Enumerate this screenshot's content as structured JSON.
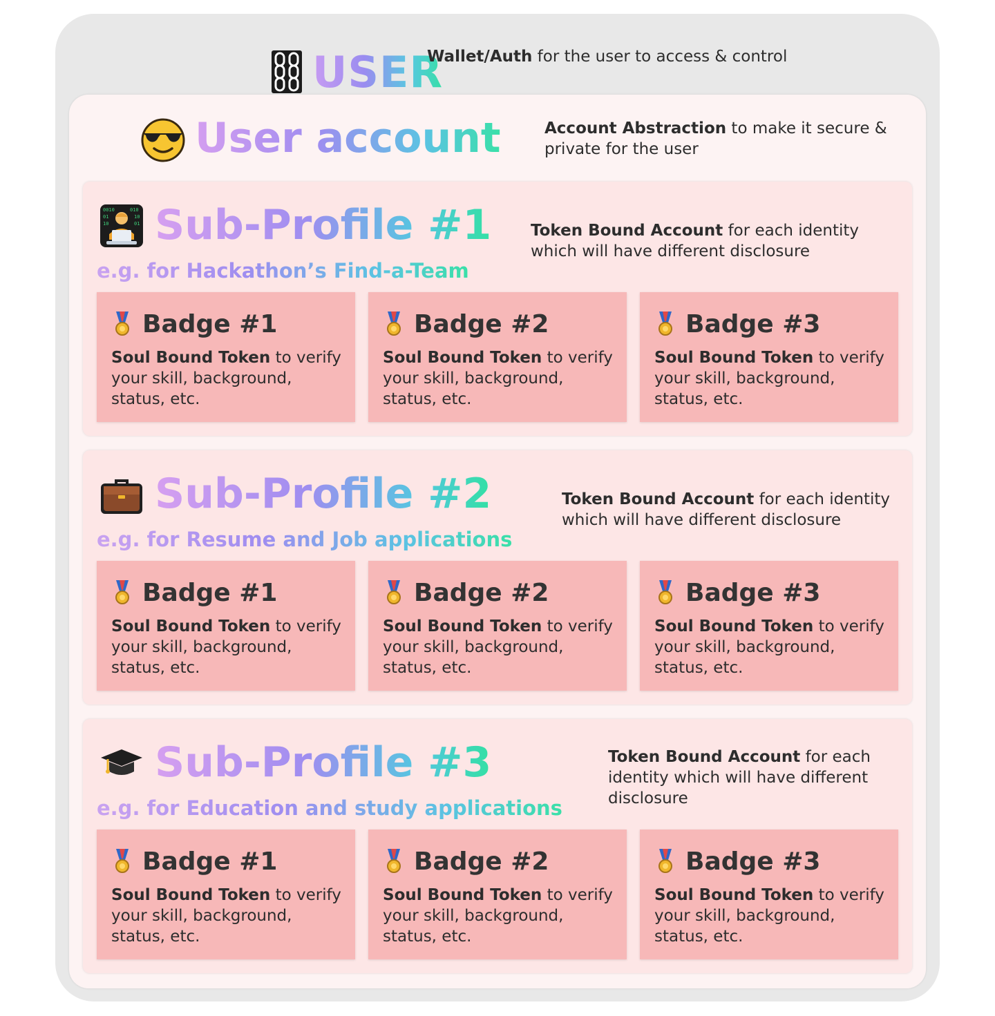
{
  "user": {
    "title": "USER",
    "desc_bold": "Wallet/Auth",
    "desc_rest": " for the user to access & control"
  },
  "account": {
    "title": "User account",
    "desc_bold": "Account Abstraction",
    "desc_rest": " to make it secure & private for the user"
  },
  "subprofiles": [
    {
      "title": "Sub-Profile #1",
      "subtitle": "e.g. for Hackathon’s Find-a-Team",
      "desc_bold": "Token Bound Account",
      "desc_rest": " for each identity which will have different disclosure",
      "icon": "technologist-icon",
      "badges": [
        {
          "title": "Badge #1",
          "desc_bold": "Soul Bound Token",
          "desc_rest": " to verify your skill, background, status, etc."
        },
        {
          "title": "Badge #2",
          "desc_bold": "Soul Bound Token",
          "desc_rest": " to verify your skill, background, status, etc."
        },
        {
          "title": "Badge #3",
          "desc_bold": "Soul Bound Token",
          "desc_rest": " to verify your skill, background, status, etc."
        }
      ]
    },
    {
      "title": "Sub-Profile #2",
      "subtitle": "e.g. for Resume and Job applications",
      "desc_bold": "Token Bound Account",
      "desc_rest": " for each identity which will have different disclosure",
      "icon": "briefcase-icon",
      "badges": [
        {
          "title": "Badge #1",
          "desc_bold": "Soul Bound Token",
          "desc_rest": " to verify your skill, background, status, etc."
        },
        {
          "title": "Badge #2",
          "desc_bold": "Soul Bound Token",
          "desc_rest": " to verify your skill, background, status, etc."
        },
        {
          "title": "Badge #3",
          "desc_bold": "Soul Bound Token",
          "desc_rest": " to verify your skill, background, status, etc."
        }
      ]
    },
    {
      "title": "Sub-Profile #3",
      "subtitle": "e.g. for Education and study applications",
      "desc_bold": "Token Bound Account",
      "desc_rest": " for each identity which will have different disclosure",
      "icon": "graduation-cap-icon",
      "badges": [
        {
          "title": "Badge #1",
          "desc_bold": "Soul Bound Token",
          "desc_rest": " to verify your skill, background, status, etc."
        },
        {
          "title": "Badge #2",
          "desc_bold": "Soul Bound Token",
          "desc_rest": " to verify your skill, background, status, etc."
        },
        {
          "title": "Badge #3",
          "desc_bold": "Soul Bound Token",
          "desc_rest": " to verify your skill, background, status, etc."
        }
      ]
    }
  ],
  "colors": {
    "outer_bg": "#e8e8e8",
    "account_bg": "#fdf3f3",
    "subprofile_bg": "#fde6e6",
    "badge_bg": "#f7b8b8",
    "gradient_start": "#c79cf2",
    "gradient_end": "#36dfa6"
  }
}
